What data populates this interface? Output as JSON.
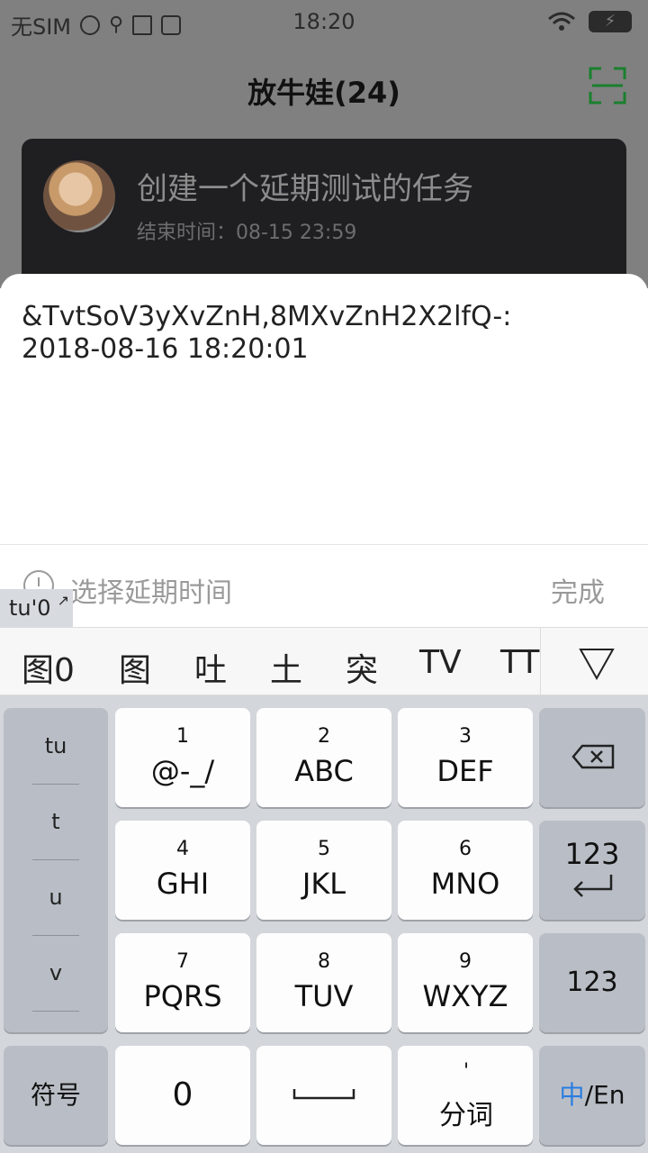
{
  "status_bar": {
    "carrier": "无SIM",
    "time": "18:20",
    "icons": [
      "globe-icon",
      "usb-icon",
      "keyboard-grid-icon",
      "usb-debug-icon",
      "wifi-icon",
      "battery-charging-icon"
    ]
  },
  "header": {
    "title": "放牛娃(24)",
    "scan_icon": "scan-icon",
    "accent_color": "#1a7f2e"
  },
  "task": {
    "title": "创建一个延期测试的任务",
    "deadline": "结束时间：08-15 23:59"
  },
  "sheet": {
    "input_text": "&TvtSoV3yXvZnH,8MXvZnH2X2lfQ-:\n2018-08-16 18:20:01",
    "select_delay": "选择延期时间",
    "done": "完成",
    "composing": "tu'0"
  },
  "ime": {
    "candidates": [
      "图0",
      "图",
      "吐",
      "土",
      "突",
      "TV",
      "TT"
    ],
    "pinyin": [
      "tu",
      "t",
      "u",
      "v"
    ],
    "keys": {
      "k1": {
        "num": "1",
        "letters": "@-_/"
      },
      "k2": {
        "num": "2",
        "letters": "ABC"
      },
      "k3": {
        "num": "3",
        "letters": "DEF"
      },
      "k4": {
        "num": "4",
        "letters": "GHI"
      },
      "k5": {
        "num": "5",
        "letters": "JKL"
      },
      "k6": {
        "num": "6",
        "letters": "MNO"
      },
      "k7": {
        "num": "7",
        "letters": "PQRS"
      },
      "k8": {
        "num": "8",
        "letters": "TUV"
      },
      "k9": {
        "num": "9",
        "letters": "WXYZ"
      },
      "k0": "0"
    },
    "enter_label": "123",
    "num_label": "123",
    "symbol_label": "符号",
    "comma": "'",
    "fenci": "分词",
    "lang_zh": "中",
    "lang_sep": "/En",
    "accent_color": "#2a7de1"
  }
}
